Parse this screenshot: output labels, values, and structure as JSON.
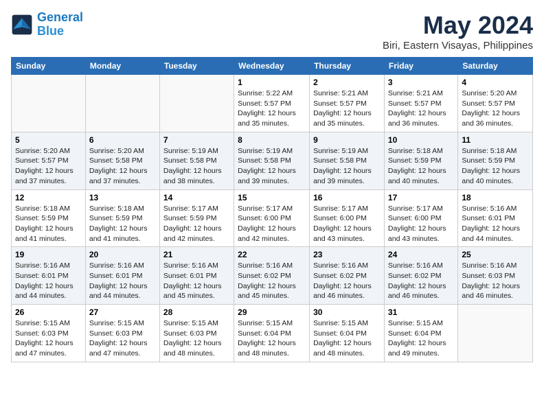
{
  "logo": {
    "line1": "General",
    "line2": "Blue"
  },
  "title": "May 2024",
  "location": "Biri, Eastern Visayas, Philippines",
  "weekdays": [
    "Sunday",
    "Monday",
    "Tuesday",
    "Wednesday",
    "Thursday",
    "Friday",
    "Saturday"
  ],
  "weeks": [
    [
      {
        "day": "",
        "info": ""
      },
      {
        "day": "",
        "info": ""
      },
      {
        "day": "",
        "info": ""
      },
      {
        "day": "1",
        "info": "Sunrise: 5:22 AM\nSunset: 5:57 PM\nDaylight: 12 hours\nand 35 minutes."
      },
      {
        "day": "2",
        "info": "Sunrise: 5:21 AM\nSunset: 5:57 PM\nDaylight: 12 hours\nand 35 minutes."
      },
      {
        "day": "3",
        "info": "Sunrise: 5:21 AM\nSunset: 5:57 PM\nDaylight: 12 hours\nand 36 minutes."
      },
      {
        "day": "4",
        "info": "Sunrise: 5:20 AM\nSunset: 5:57 PM\nDaylight: 12 hours\nand 36 minutes."
      }
    ],
    [
      {
        "day": "5",
        "info": "Sunrise: 5:20 AM\nSunset: 5:57 PM\nDaylight: 12 hours\nand 37 minutes."
      },
      {
        "day": "6",
        "info": "Sunrise: 5:20 AM\nSunset: 5:58 PM\nDaylight: 12 hours\nand 37 minutes."
      },
      {
        "day": "7",
        "info": "Sunrise: 5:19 AM\nSunset: 5:58 PM\nDaylight: 12 hours\nand 38 minutes."
      },
      {
        "day": "8",
        "info": "Sunrise: 5:19 AM\nSunset: 5:58 PM\nDaylight: 12 hours\nand 39 minutes."
      },
      {
        "day": "9",
        "info": "Sunrise: 5:19 AM\nSunset: 5:58 PM\nDaylight: 12 hours\nand 39 minutes."
      },
      {
        "day": "10",
        "info": "Sunrise: 5:18 AM\nSunset: 5:59 PM\nDaylight: 12 hours\nand 40 minutes."
      },
      {
        "day": "11",
        "info": "Sunrise: 5:18 AM\nSunset: 5:59 PM\nDaylight: 12 hours\nand 40 minutes."
      }
    ],
    [
      {
        "day": "12",
        "info": "Sunrise: 5:18 AM\nSunset: 5:59 PM\nDaylight: 12 hours\nand 41 minutes."
      },
      {
        "day": "13",
        "info": "Sunrise: 5:18 AM\nSunset: 5:59 PM\nDaylight: 12 hours\nand 41 minutes."
      },
      {
        "day": "14",
        "info": "Sunrise: 5:17 AM\nSunset: 5:59 PM\nDaylight: 12 hours\nand 42 minutes."
      },
      {
        "day": "15",
        "info": "Sunrise: 5:17 AM\nSunset: 6:00 PM\nDaylight: 12 hours\nand 42 minutes."
      },
      {
        "day": "16",
        "info": "Sunrise: 5:17 AM\nSunset: 6:00 PM\nDaylight: 12 hours\nand 43 minutes."
      },
      {
        "day": "17",
        "info": "Sunrise: 5:17 AM\nSunset: 6:00 PM\nDaylight: 12 hours\nand 43 minutes."
      },
      {
        "day": "18",
        "info": "Sunrise: 5:16 AM\nSunset: 6:01 PM\nDaylight: 12 hours\nand 44 minutes."
      }
    ],
    [
      {
        "day": "19",
        "info": "Sunrise: 5:16 AM\nSunset: 6:01 PM\nDaylight: 12 hours\nand 44 minutes."
      },
      {
        "day": "20",
        "info": "Sunrise: 5:16 AM\nSunset: 6:01 PM\nDaylight: 12 hours\nand 44 minutes."
      },
      {
        "day": "21",
        "info": "Sunrise: 5:16 AM\nSunset: 6:01 PM\nDaylight: 12 hours\nand 45 minutes."
      },
      {
        "day": "22",
        "info": "Sunrise: 5:16 AM\nSunset: 6:02 PM\nDaylight: 12 hours\nand 45 minutes."
      },
      {
        "day": "23",
        "info": "Sunrise: 5:16 AM\nSunset: 6:02 PM\nDaylight: 12 hours\nand 46 minutes."
      },
      {
        "day": "24",
        "info": "Sunrise: 5:16 AM\nSunset: 6:02 PM\nDaylight: 12 hours\nand 46 minutes."
      },
      {
        "day": "25",
        "info": "Sunrise: 5:16 AM\nSunset: 6:03 PM\nDaylight: 12 hours\nand 46 minutes."
      }
    ],
    [
      {
        "day": "26",
        "info": "Sunrise: 5:15 AM\nSunset: 6:03 PM\nDaylight: 12 hours\nand 47 minutes."
      },
      {
        "day": "27",
        "info": "Sunrise: 5:15 AM\nSunset: 6:03 PM\nDaylight: 12 hours\nand 47 minutes."
      },
      {
        "day": "28",
        "info": "Sunrise: 5:15 AM\nSunset: 6:03 PM\nDaylight: 12 hours\nand 48 minutes."
      },
      {
        "day": "29",
        "info": "Sunrise: 5:15 AM\nSunset: 6:04 PM\nDaylight: 12 hours\nand 48 minutes."
      },
      {
        "day": "30",
        "info": "Sunrise: 5:15 AM\nSunset: 6:04 PM\nDaylight: 12 hours\nand 48 minutes."
      },
      {
        "day": "31",
        "info": "Sunrise: 5:15 AM\nSunset: 6:04 PM\nDaylight: 12 hours\nand 49 minutes."
      },
      {
        "day": "",
        "info": ""
      }
    ]
  ]
}
